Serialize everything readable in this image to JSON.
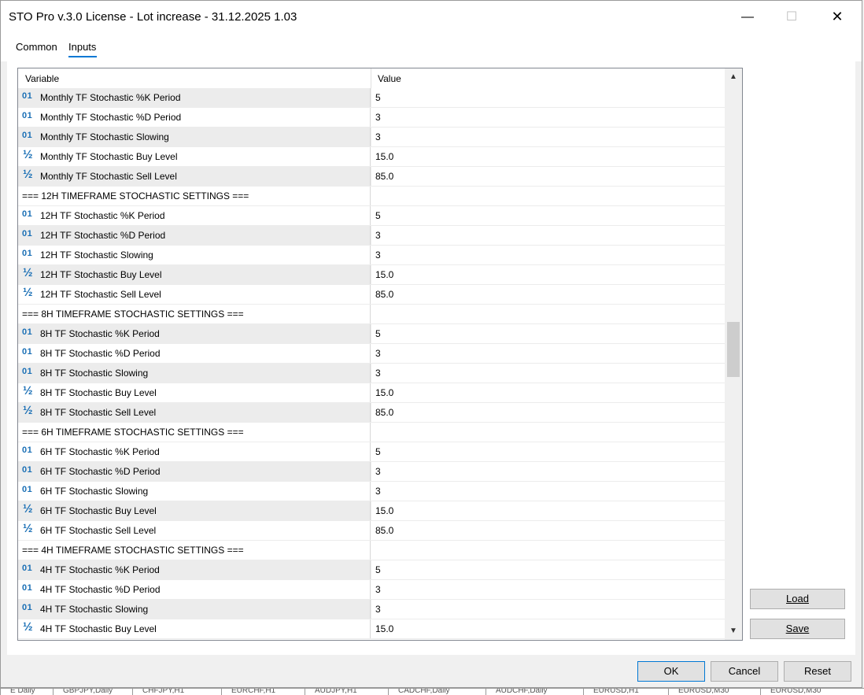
{
  "window": {
    "title": "STO Pro v.3.0 License - Lot increase - 31.12.2025 1.03",
    "minimize": "—",
    "maximize": "☐",
    "close": "✕"
  },
  "tabs": [
    {
      "label": "Common",
      "active": false
    },
    {
      "label": "Inputs",
      "active": true
    }
  ],
  "grid": {
    "header": {
      "variable": "Variable",
      "value": "Value"
    },
    "rows": [
      {
        "type": "int",
        "icon": "01",
        "name": "Monthly TF Stochastic %K Period",
        "value": "5"
      },
      {
        "type": "int",
        "icon": "01",
        "name": "Monthly TF Stochastic %D Period",
        "value": "3"
      },
      {
        "type": "int",
        "icon": "01",
        "name": "Monthly TF Stochastic Slowing",
        "value": "3"
      },
      {
        "type": "double",
        "icon": "½",
        "name": "Monthly TF Stochastic Buy Level",
        "value": "15.0"
      },
      {
        "type": "double",
        "icon": "½",
        "name": "Monthly TF Stochastic Sell Level",
        "value": "85.0"
      },
      {
        "type": "section",
        "icon": "",
        "name": "=== 12H TIMEFRAME STOCHASTIC SETTINGS ===",
        "value": ""
      },
      {
        "type": "int",
        "icon": "01",
        "name": "12H TF Stochastic %K Period",
        "value": "5"
      },
      {
        "type": "int",
        "icon": "01",
        "name": "12H TF Stochastic %D Period",
        "value": "3"
      },
      {
        "type": "int",
        "icon": "01",
        "name": "12H TF Stochastic Slowing",
        "value": "3"
      },
      {
        "type": "double",
        "icon": "½",
        "name": "12H TF Stochastic Buy Level",
        "value": "15.0"
      },
      {
        "type": "double",
        "icon": "½",
        "name": "12H TF Stochastic Sell Level",
        "value": "85.0"
      },
      {
        "type": "section",
        "icon": "",
        "name": "=== 8H TIMEFRAME STOCHASTIC SETTINGS ===",
        "value": ""
      },
      {
        "type": "int",
        "icon": "01",
        "name": "8H TF Stochastic %K Period",
        "value": "5"
      },
      {
        "type": "int",
        "icon": "01",
        "name": "8H TF Stochastic %D Period",
        "value": "3"
      },
      {
        "type": "int",
        "icon": "01",
        "name": "8H TF Stochastic Slowing",
        "value": "3"
      },
      {
        "type": "double",
        "icon": "½",
        "name": "8H TF Stochastic Buy Level",
        "value": "15.0"
      },
      {
        "type": "double",
        "icon": "½",
        "name": "8H TF Stochastic Sell Level",
        "value": "85.0"
      },
      {
        "type": "section",
        "icon": "",
        "name": "=== 6H TIMEFRAME STOCHASTIC SETTINGS ===",
        "value": ""
      },
      {
        "type": "int",
        "icon": "01",
        "name": "6H TF Stochastic %K Period",
        "value": "5"
      },
      {
        "type": "int",
        "icon": "01",
        "name": "6H TF Stochastic %D Period",
        "value": "3"
      },
      {
        "type": "int",
        "icon": "01",
        "name": "6H TF Stochastic Slowing",
        "value": "3"
      },
      {
        "type": "double",
        "icon": "½",
        "name": "6H TF Stochastic Buy Level",
        "value": "15.0"
      },
      {
        "type": "double",
        "icon": "½",
        "name": "6H TF Stochastic Sell Level",
        "value": "85.0"
      },
      {
        "type": "section",
        "icon": "",
        "name": "=== 4H TIMEFRAME STOCHASTIC SETTINGS ===",
        "value": ""
      },
      {
        "type": "int",
        "icon": "01",
        "name": "4H TF Stochastic %K Period",
        "value": "5"
      },
      {
        "type": "int",
        "icon": "01",
        "name": "4H TF Stochastic %D Period",
        "value": "3"
      },
      {
        "type": "int",
        "icon": "01",
        "name": "4H TF Stochastic Slowing",
        "value": "3"
      },
      {
        "type": "double",
        "icon": "½",
        "name": "4H TF Stochastic Buy Level",
        "value": "15.0"
      }
    ]
  },
  "scrollbar": {
    "up": "▲",
    "down": "▼"
  },
  "buttons": {
    "load": "Load",
    "save": "Save",
    "ok": "OK",
    "cancel": "Cancel",
    "reset": "Reset"
  },
  "colors": {
    "accent": "#0078d4",
    "icon": "#1a6fb5",
    "stripe": "#ececec"
  },
  "taskbar": [
    "E Daily",
    "GBPJPY,Daily",
    "CHFJPY,H1",
    "EURCHF,H1",
    "AUDJPY,H1",
    "CADCHF,Daily",
    "AUDCHF,Daily",
    "EURUSD,H1",
    "EURUSD,M30",
    "EURUSD,M30"
  ]
}
